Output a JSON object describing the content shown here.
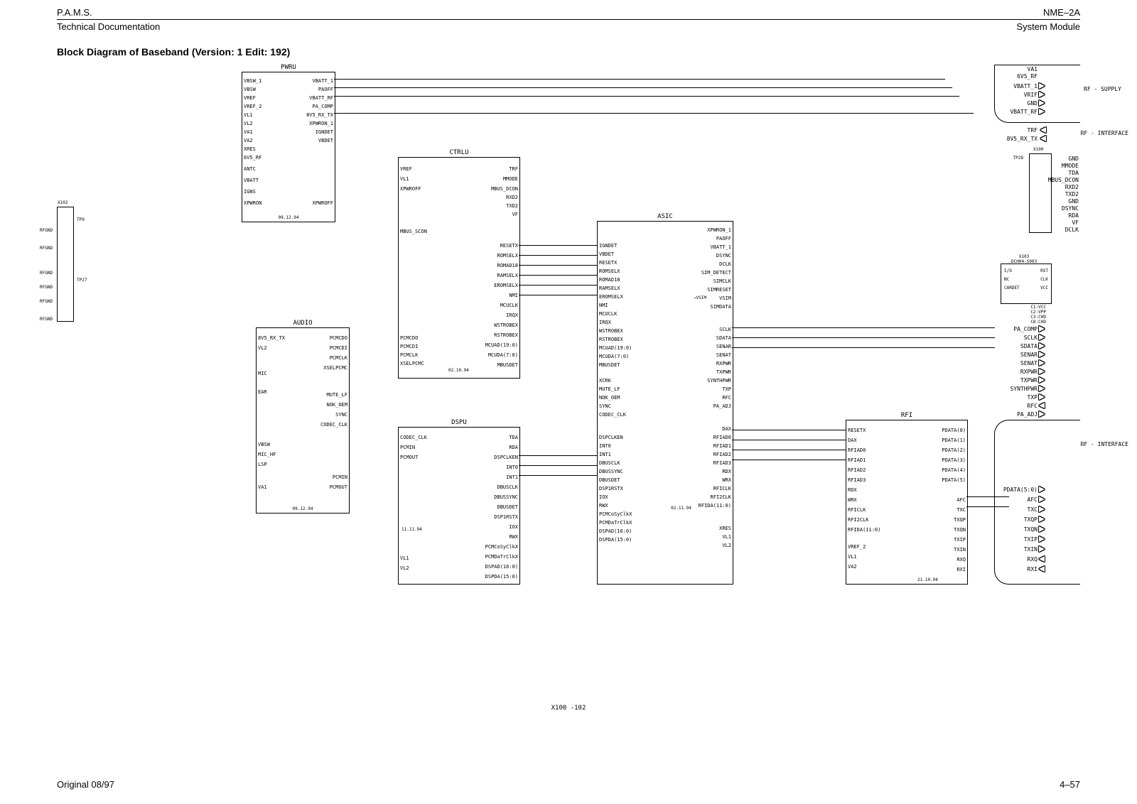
{
  "header": {
    "left_top": "P.A.M.S.",
    "left_sub": "Technical Documentation",
    "right_top": "NME–2A",
    "right_sub": "System Module"
  },
  "title": "Block Diagram of Baseband (Version: 1  Edit: 192)",
  "footer": {
    "center": "X100 -102",
    "left": "Original 08/97",
    "right": "4–57"
  },
  "side_labels": {
    "rf_supply": "RF - SUPPLY",
    "rf_interface_top": "RF - INTERFACE",
    "rf_interface_bottom": "RF - INTERFACE"
  },
  "blocks": {
    "pwru": {
      "title": "PWRU",
      "date": "09.12.94",
      "left_pins": [
        "VBSW_1",
        "VBSW",
        "VREF",
        "VREF_2",
        "VL1",
        "VL2",
        "VA1",
        "VA2",
        "XRES",
        "6V5_RF",
        "ANTC",
        "VBATT",
        "IGNS",
        "XPWRON"
      ],
      "right_pins": [
        "VBATT_1",
        "PAOFF",
        "VBATT_RF",
        "PA_COMP",
        "8V5_RX_TX",
        "XPWRON_1",
        "IGNDET",
        "VBDET",
        "",
        "",
        "",
        "",
        "",
        "XPWROFF"
      ]
    },
    "ctrlu": {
      "title": "CTRLU",
      "left_pins": [
        "VREF",
        "VL1",
        "XPWROFF",
        "",
        "",
        "",
        "",
        "MBUS_SCON"
      ],
      "right_pins": [
        "TRF",
        "MMODE",
        "MBUS_DCON",
        "RXD2",
        "TXD2",
        "VF",
        "",
        "",
        "RESETX",
        "ROMSELX",
        "ROMAD18",
        "RAMSELX",
        "EROMSELX",
        "NMI",
        "MCUCLK",
        "IRQX",
        "WSTROBEX",
        "RSTROBEX",
        "MCUAD(19:0)",
        "MCUDA(7:0)",
        "MBUSDET"
      ],
      "extra_left": [
        "PCMCDO",
        "PCMCDI",
        "PCMCLK",
        "XSELPCMC"
      ],
      "date": "02.10.94"
    },
    "audio": {
      "title": "AUDIO",
      "date": "09.12.94",
      "left_pins": [
        "8V5_RX_TX",
        "VL2",
        "",
        "MIC",
        "EAR",
        "",
        "",
        "",
        "VBSW",
        "MIC_HF",
        "LSP",
        "",
        "VA1"
      ],
      "right_pins": [
        "PCMCDO",
        "PCMCDI",
        "PCMCLK",
        "XSELPCMC",
        "",
        "",
        "MUTE_LF",
        "NOK_OEM",
        "SYNC",
        "CODEC_CLK",
        "",
        "",
        "",
        "PCMIN",
        "PCMOUT"
      ]
    },
    "dspu": {
      "title": "DSPU",
      "date": "11.11.94",
      "left_pins": [
        "CODEC_CLK",
        "PCMIN",
        "PCMOUT",
        "",
        "",
        "",
        "",
        "",
        "",
        "",
        "",
        "VL1",
        "VL2"
      ],
      "right_pins": [
        "TDA",
        "RDA",
        "DSPCLKEN",
        "INT0",
        "INT1",
        "DBUSCLK",
        "DBUSSYNC",
        "DBUSDET",
        "DSP1RSTX",
        "IOX",
        "RWX",
        "PCMCoSyClkX",
        "PCMDaTrClkX",
        "DSPAD(16:0)",
        "DSPDA(15:0)"
      ]
    },
    "asic": {
      "title": "ASIC",
      "date": "02.11.94",
      "left_pins": [
        "",
        "IGNDET",
        "VBDET",
        "RESETX",
        "ROMSELX",
        "ROMAD18",
        "RAMSELX",
        "EROMSELX",
        "NMI",
        "MCUCLK",
        "IRQX",
        "WSTROBEX",
        "RSTROBEX",
        "MCUAD(19:0)",
        "MCUDA(7:0)",
        "MBUSDET",
        "",
        "XCRK",
        "MUTE_LF",
        "NOK_OEM",
        "SYNC",
        "CODEC_CLK",
        "",
        "",
        "",
        "DSPCLKEN",
        "INT0",
        "INT1",
        "DBUSCLK",
        "DBUSSYNC",
        "DBUSDET",
        "DSP1RSTX",
        "IOX",
        "RWX",
        "PCMCoSyClkX",
        "PCMDaTrClkX",
        "DSPAD(16:0)",
        "DSPDA(15:0)"
      ],
      "right_pins": [
        "XPWRON_1",
        "PAOFF",
        "VBATT_1",
        "DSYNC",
        "DCLK",
        "SIM_DETECT",
        "SIMCLK",
        "SIMRESET",
        "VSIM",
        "SIMDATA",
        "",
        "SCLK",
        "SDATA",
        "SENAR",
        "SENAT",
        "RXPWR",
        "TXPWR",
        "SYNTHPWR",
        "TXP",
        "RFC",
        "PA_ADJ",
        "",
        "DAX",
        "RFIAD0",
        "RFIAD1",
        "RFIAD2",
        "RFIAD3",
        "RDX",
        "WRX",
        "RFICLK",
        "RFI2CLK",
        "RFIDA(11:0)",
        "XRES",
        "VL1",
        "VL2"
      ]
    },
    "rfi": {
      "title": "RFI",
      "date": "21.10.94",
      "left_pins": [
        "RESETX",
        "DAX",
        "RFIAD0",
        "RFIAD1",
        "RFIAD2",
        "RFIAD3",
        "RDX",
        "WRX",
        "RFICLK",
        "RFI2CLK",
        "RFIDA(11:0)",
        "VREF_2",
        "VL1",
        "VA2"
      ],
      "right_pins": [
        "PDATA(0)",
        "PDATA(1)",
        "PDATA(2)",
        "PDATA(3)",
        "PDATA(4)",
        "PDATA(5)",
        "",
        "AFC",
        "TXC",
        "TXQP",
        "TXQN",
        "TXIP",
        "TXIN",
        "RXQ",
        "RXI"
      ]
    }
  },
  "rf_supply_pins": [
    "VA1",
    "6V5_RF",
    "VBATT_1",
    "VRIF",
    "GND",
    "VBATT_RF"
  ],
  "rf_if_top_pins": [
    "TRF",
    "8V5_RX_TX"
  ],
  "conn_x100": {
    "label": "X100",
    "note": "TP28",
    "pins_right": [
      "GND",
      "MMODE",
      "TDA",
      "MBUS_DCON",
      "RXD2",
      "TXD2",
      "GND",
      "DSYNC",
      "RDA",
      "VF",
      "DCLK"
    ]
  },
  "conn_x103": {
    "label": "X103",
    "sub": "DCH04-S003",
    "rows": [
      "I/O",
      "NC",
      "CARDET"
    ],
    "right": [
      "RST",
      "CLK",
      "VCC"
    ],
    "bottom": [
      "C1:VCC",
      "C2:VPP",
      "C3:CHD",
      "C8:CHD"
    ]
  },
  "rf_if_bottom_pins": [
    "PA_COMP",
    "SCLK",
    "SDATA",
    "SENAR",
    "SENAT",
    "RXPWR",
    "TXPWR",
    "SYNTHPWR",
    "TXP",
    "RFC",
    "PA_ADJ"
  ],
  "rfi_out_pins": [
    "PDATA(5:0)",
    "AFC",
    "TXC",
    "TXQP",
    "TXQN",
    "TXIP",
    "TXIN",
    "RXQ",
    "RXI"
  ],
  "left_conn": {
    "label": "X102",
    "tp": [
      "TP9",
      "",
      "",
      "",
      "",
      "TP27"
    ],
    "ground": "RFGND"
  },
  "vl_vref_labels": [
    "VL1",
    "VREF",
    "VL2",
    "VL1",
    "VA1",
    "VREF",
    "VBSW",
    "VREF_2",
    "VA2",
    "XRES",
    "6V5_RF"
  ],
  "asic_extra": {
    "vsim_arrow": "VSIM"
  }
}
